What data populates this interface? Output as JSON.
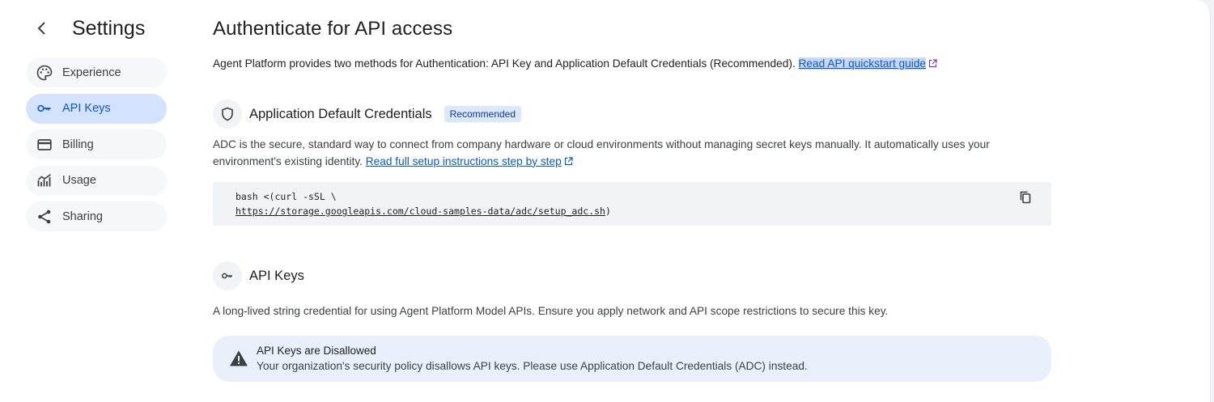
{
  "sidebar": {
    "title": "Settings",
    "items": [
      {
        "label": "Experience",
        "icon": "palette-icon"
      },
      {
        "label": "API Keys",
        "icon": "key-icon",
        "active": true
      },
      {
        "label": "Billing",
        "icon": "credit-card-icon"
      },
      {
        "label": "Usage",
        "icon": "chart-icon"
      },
      {
        "label": "Sharing",
        "icon": "share-icon"
      }
    ]
  },
  "main": {
    "title": "Authenticate for API access",
    "intro": "Agent Platform provides two methods for Authentication: API Key and Application Default Credentials (Recommended). ",
    "intro_link": "Read API quickstart guide",
    "adc": {
      "title": "Application Default Credentials",
      "badge": "Recommended",
      "desc_line1": "ADC is the secure, standard way to connect from company hardware or cloud environments without managing secret keys manually. It automatically uses your",
      "desc_line2": "environment's existing identity. ",
      "desc_link": "Read full setup instructions step by step",
      "code_line1": "bash <(curl -sSL \\",
      "code_line2_link": "https://storage.googleapis.com/cloud-samples-data/adc/setup_adc.sh",
      "code_line2_tail": ")"
    },
    "api_keys": {
      "title": "API Keys",
      "desc": "A long-lived string credential for using Agent Platform Model APIs. Ensure you apply network and API scope restrictions to secure this key.",
      "alert_title": "API Keys are Disallowed",
      "alert_body": "Your organization's security policy disallows API keys. Please use Application Default Credentials (ADC) instead."
    }
  },
  "colors": {
    "accent": "#0b57d0",
    "active_nav_bg": "#d3e3fd",
    "alert_bg": "#eaf0fb"
  }
}
